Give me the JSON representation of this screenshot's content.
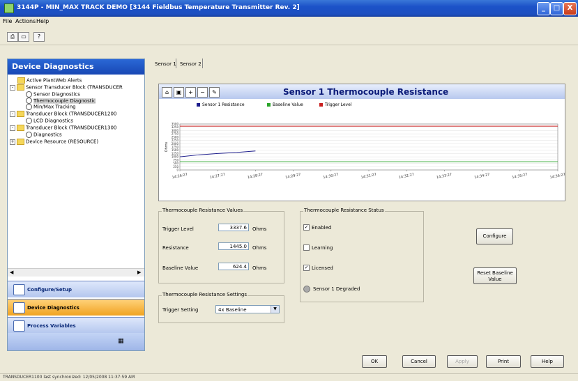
{
  "window": {
    "title": "3144P - MIN_MAX TRACK DEMO [3144 Fieldbus Temperature Transmitter Rev. 2]",
    "controls": {
      "minimize": "_",
      "maximize": "□",
      "close": "X"
    }
  },
  "menu": {
    "items": [
      "File",
      "Actions",
      "Help"
    ]
  },
  "toolbar": {
    "icons": [
      "print-icon",
      "print-preview-icon",
      "help-icon"
    ]
  },
  "left_panel": {
    "header": "Device Diagnostics",
    "tree": [
      {
        "label": "Active PlantWeb Alerts",
        "expander": ""
      },
      {
        "label": "Sensor Transducer Block (TRANSDUCER",
        "expander": "-"
      },
      {
        "label": "Sensor Diagnostics",
        "expander": ""
      },
      {
        "label": "Thermocouple Diagnostic",
        "expander": ""
      },
      {
        "label": "Min/Max Tracking",
        "expander": ""
      },
      {
        "label": "Transducer Block (TRANSDUCER1200",
        "expander": "-"
      },
      {
        "label": "LCD Diagnostics",
        "expander": ""
      },
      {
        "label": "Transducer Block (TRANSDUCER1300",
        "expander": "-"
      },
      {
        "label": "Diagnostics",
        "expander": ""
      },
      {
        "label": "Device Resource (RESOURCE)",
        "expander": "+"
      }
    ],
    "nav_buttons": [
      {
        "label": "Configure/Setup",
        "active": false
      },
      {
        "label": "Device Diagnostics",
        "active": true
      },
      {
        "label": "Process Variables",
        "active": false
      }
    ]
  },
  "tabs": [
    "Sensor 1",
    "Sensor 2"
  ],
  "chart": {
    "title": "Sensor 1 Thermocouple Resistance",
    "legend": [
      {
        "label": "Sensor 1 Resistance",
        "color": "#1e1e8c"
      },
      {
        "label": "Baseline Value",
        "color": "#2aa52a"
      },
      {
        "label": "Trigger Level",
        "color": "#c81e1e"
      }
    ],
    "ylabel": "Ohms",
    "y_ticks": [
      "3500",
      "3250",
      "3000",
      "2750",
      "2500",
      "2250",
      "2000",
      "1750",
      "1500",
      "1250",
      "1000",
      "750",
      "500",
      "250",
      "0"
    ],
    "x_ticks": [
      "14:26:27",
      "14:27:27",
      "14:28:27",
      "14:29:27",
      "14:30:27",
      "14:31:27",
      "14:32:27",
      "14:33:27",
      "14:34:27",
      "14:35:27",
      "14:36:27"
    ]
  },
  "chart_data": {
    "type": "line",
    "title": "Sensor 1 Thermocouple Resistance",
    "ylabel": "Ohms",
    "ylim": [
      0,
      3500
    ],
    "xlim": [
      0,
      10
    ],
    "x_unit_note_removed": "",
    "series": [
      {
        "name": "Sensor 1 Resistance",
        "color": "#1e1e8c",
        "x": [
          0,
          0.5,
          1.0,
          1.5,
          2.0
        ],
        "y": [
          1000,
          1150,
          1250,
          1330,
          1445
        ]
      },
      {
        "name": "Baseline Value",
        "color": "#2aa52a",
        "x": [
          0,
          10
        ],
        "y": [
          624,
          624
        ]
      },
      {
        "name": "Trigger Level",
        "color": "#c81e1e",
        "x": [
          0,
          10
        ],
        "y": [
          3337,
          3337
        ]
      }
    ]
  },
  "values_group": {
    "title": "Thermocouple Resistance Values",
    "trigger_label": "Trigger Level",
    "trigger_value": "3337.6",
    "resistance_label": "Resistance",
    "resistance_value": "1445.0",
    "baseline_label": "Baseline Value",
    "baseline_value": "624.4",
    "unit": "Ohms"
  },
  "settings_group": {
    "title": "Thermocouple Resistance Settings",
    "trigger_setting_label": "Trigger Setting",
    "trigger_setting_value": "4x Baseline"
  },
  "status_group": {
    "title": "Thermocouple Resistance Status",
    "items": [
      {
        "label": "Enabled",
        "checked": true
      },
      {
        "label": "Learning",
        "checked": false
      },
      {
        "label": "Licensed",
        "checked": true
      }
    ],
    "degraded_label": "Sensor 1 Degraded"
  },
  "buttons": {
    "configure": "Configure",
    "reset_baseline": "Reset Baseline Value",
    "ok": "OK",
    "cancel": "Cancel",
    "apply": "Apply",
    "print": "Print",
    "help": "Help"
  },
  "statusbar": {
    "text": "TRANSDUCER1100 last synchronized: 12/05/2008 11:37:59 AM"
  }
}
